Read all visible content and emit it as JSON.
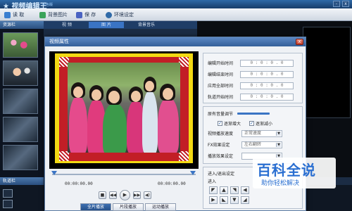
{
  "app": {
    "logo": "★ 视频编辑王",
    "logo_tag": "彩色版",
    "win_min": "-",
    "win_close": "x"
  },
  "toolbar": {
    "read": "读 取",
    "bg_image": "背景图片",
    "save": "保 存",
    "env_settings": "环境设定"
  },
  "left_panel": {
    "header": "资源栏"
  },
  "top_tabs": [
    "视 频",
    "图 片",
    "背景音乐"
  ],
  "track_panel": {
    "header": "轨道栏"
  },
  "dialog": {
    "title": "视频属性",
    "close": "x",
    "time_left": "00:00:00.00",
    "time_right": "00:00:00.00",
    "mode_tabs": [
      "全片播放",
      "片段播放",
      "运动播放"
    ],
    "timing": [
      {
        "label": "编辑开始时间",
        "value": "0 : 0 : 0 . 0"
      },
      {
        "label": "编辑结束时间",
        "value": "0 : 0 : 0 . 0"
      },
      {
        "label": "应用全部时间",
        "value": "0 : 0 : 0 . 0"
      },
      {
        "label": "轨道开始时间",
        "value": "0 : 0 : 0 . 0"
      }
    ],
    "settings": {
      "volume_label": "原有音量调节",
      "fade_in": "逐渐增大",
      "fade_out": "逐渐减小",
      "speed_label": "视频播放速度",
      "speed_value": "正常速度",
      "fx_label": "FX效果设定",
      "fx_value": "左右翻转",
      "filter_label": "播放效果设定",
      "filter_value": "",
      "enter_exit_label": "进入/退出设定",
      "enter_label": "进入"
    }
  },
  "watermark": {
    "main": "百科全说",
    "sub": "助你轻松解决"
  }
}
